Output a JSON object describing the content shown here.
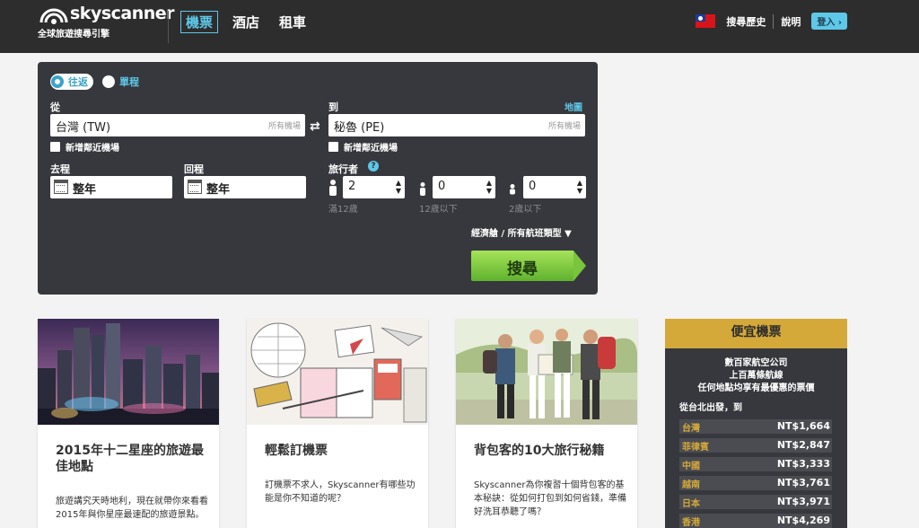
{
  "header": {
    "logo_text": "skyscanner",
    "logo_sub": "全球旅遊搜尋引擎",
    "nav": [
      "機票",
      "酒店",
      "租車"
    ],
    "links": [
      "搜尋歷史",
      "說明"
    ],
    "login": "登入",
    "login_arrow": "›"
  },
  "search": {
    "trip_types": [
      "往返",
      "單程"
    ],
    "from_label": "從",
    "to_label": "到",
    "map_link": "地圖",
    "from_value": "台灣 (TW)",
    "to_value": "秘魯 (PE)",
    "all_airports": "所有機場",
    "swap_icon": "⇄",
    "nearby_label": "新增鄰近機場",
    "depart_label": "去程",
    "return_label": "回程",
    "depart_value": "整年",
    "return_value": "整年",
    "travellers_label": "旅行者",
    "help": "?",
    "adults": "2",
    "children": "0",
    "infants": "0",
    "adults_sub": "滿12歲",
    "children_sub": "12歲以下",
    "infants_sub": "2歲以下",
    "cabin": "經濟艙 / 所有航班類型 ▼",
    "search_button": "搜尋"
  },
  "cards": [
    {
      "title": "2015年十二星座的旅遊最佳地點",
      "desc": "旅遊講究天時地利，現在就帶你來看看2015年與你星座最速配的旅遊景點。"
    },
    {
      "title": "輕鬆訂機票",
      "desc": "訂機票不求人，Skyscanner有哪些功能是你不知道的呢？"
    },
    {
      "title": "背包客的10大旅行秘籍",
      "desc": "Skyscanner為你複習十個背包客的基本秘訣：從如何打包到如何省錢，準備好洗耳恭聽了嗎？"
    }
  ],
  "cheap": {
    "title": "便宜機票",
    "lines": [
      "數百家航空公司",
      "上百萬條航線",
      "任何地點均享有最優惠的票價"
    ],
    "from": "從台北出發，到",
    "prices": [
      {
        "city": "台灣",
        "price": "NT$1,664"
      },
      {
        "city": "菲律賓",
        "price": "NT$2,847"
      },
      {
        "city": "中國",
        "price": "NT$3,333"
      },
      {
        "city": "越南",
        "price": "NT$3,761"
      },
      {
        "city": "日本",
        "price": "NT$3,971"
      },
      {
        "city": "香港",
        "price": "NT$4,269"
      }
    ]
  }
}
